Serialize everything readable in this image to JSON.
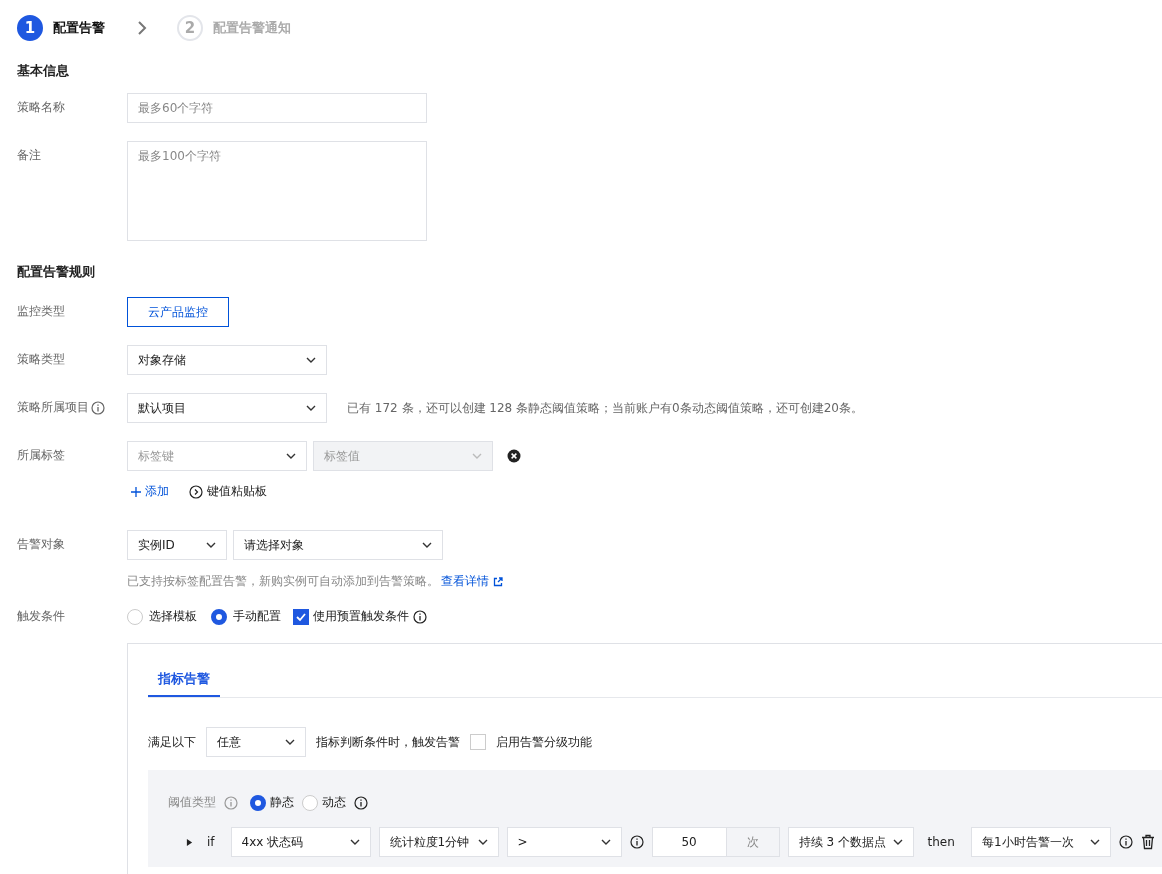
{
  "steps": [
    {
      "number": "1",
      "label": "配置告警",
      "selected": true
    },
    {
      "number": "2",
      "label": "配置告警通知",
      "selected": false
    }
  ],
  "basic_info": {
    "title": "基本信息",
    "policy_name": {
      "label": "策略名称",
      "placeholder": "最多60个字符"
    },
    "remark": {
      "label": "备注",
      "placeholder": "最多100个字符"
    }
  },
  "rules": {
    "title": "配置告警规则",
    "monitor_type": {
      "label": "监控类型",
      "button": "云产品监控"
    },
    "policy_type": {
      "label": "策略类型",
      "value": "对象存储"
    },
    "project": {
      "label": "策略所属项目",
      "value": "默认项目",
      "note": "已有 172 条，还可以创建 128 条静态阈值策略；当前账户有0条动态阈值策略，还可创建20条。"
    },
    "tags": {
      "label": "所属标签",
      "key_placeholder": "标签键",
      "value_placeholder": "标签值",
      "value_disabled": true,
      "add": "添加",
      "clipboard": "键值粘贴板"
    },
    "target": {
      "label": "告警对象",
      "type_value": "实例ID",
      "object_placeholder": "请选择对象",
      "hint": "已支持按标签配置告警，新购实例可自动添加到告警策略。",
      "link": "查看详情"
    },
    "trigger": {
      "label": "触发条件",
      "options": [
        {
          "label": "选择模板",
          "selected": false
        },
        {
          "label": "手动配置",
          "selected": true
        }
      ],
      "preset": {
        "label": "使用预置触发条件",
        "checked": true
      }
    }
  },
  "panel": {
    "tabs": [
      {
        "label": "指标告警",
        "selected": true
      }
    ],
    "condition": {
      "prefix": "满足以下",
      "value": "任意",
      "suffix": "指标判断条件时，触发告警",
      "grading": {
        "label": "启用告警分级功能",
        "checked": false
      }
    },
    "threshold": {
      "label": "阈值类型",
      "options": [
        {
          "label": "静态",
          "selected": true
        },
        {
          "label": "动态",
          "selected": false
        }
      ]
    },
    "rule": {
      "if": "if",
      "metric": "4xx 状态码",
      "granularity": "统计粒度1分钟",
      "operator": ">",
      "value": "50",
      "unit": "次",
      "duration": "持续 3 个数据点",
      "then": "then",
      "frequency": "每1小时告警一次"
    }
  }
}
